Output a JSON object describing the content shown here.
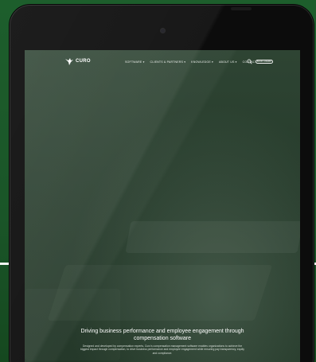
{
  "brand": {
    "logo_text": "CURO"
  },
  "nav": {
    "items": [
      "SOFTWARE ▾",
      "CLIENTS & PARTNERS ▾",
      "KNOWLEDGE ▾",
      "ABOUT US ▾",
      "CONTACT"
    ],
    "cta_label": "BOOK A DEMO"
  },
  "hero": {
    "title": "Driving business performance and employee engagement through compensation software",
    "subtitle": "Designed and developed by compensation experts, Curo's compensation management software enables organizations to achieve the biggest impact through compensation, to drive business performance and employee engagement while ensuring pay transparency, equity and compliance."
  },
  "colors": {
    "background": "#1c5a2a",
    "device": "#0c0c0c",
    "screen_overlay": "#2e4433"
  }
}
